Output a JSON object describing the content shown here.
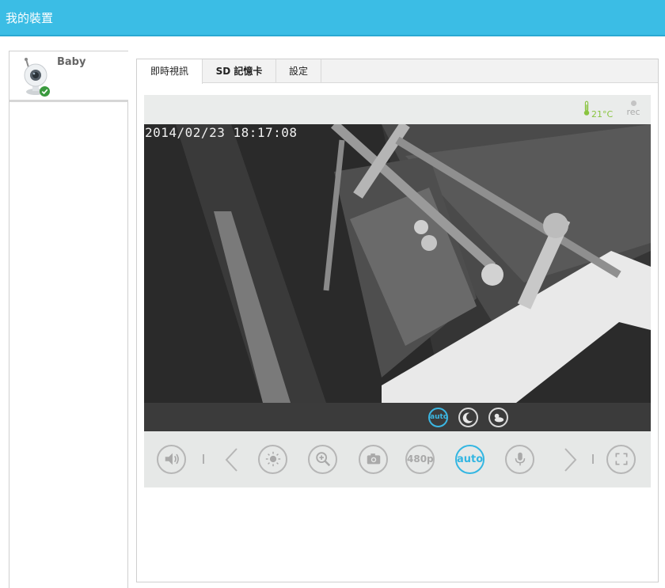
{
  "header": {
    "title": "我的裝置"
  },
  "devices": [
    {
      "name": "Baby",
      "status": "online"
    }
  ],
  "tabs": [
    {
      "label": "即時視訊",
      "active": true
    },
    {
      "label": "SD 記憶卡",
      "active": false
    },
    {
      "label": "設定",
      "active": false
    }
  ],
  "status": {
    "temperature": "21°C",
    "rec_label": "rec"
  },
  "video": {
    "timestamp": "2014/02/23 18:17:08"
  },
  "modes": [
    {
      "label": "auto",
      "icon": "auto-mode-icon",
      "selected": true
    },
    {
      "label": "",
      "icon": "night-mode-icon",
      "selected": false
    },
    {
      "label": "",
      "icon": "day-night-mode-icon",
      "selected": false
    }
  ],
  "controls": {
    "volume": "volume-icon",
    "prev": "chevron-left-icon",
    "brightness": "brightness-icon",
    "zoom": "zoom-in-icon",
    "snapshot": "camera-icon",
    "resolution_label": "480p",
    "mode_label": "auto",
    "mic": "microphone-icon",
    "next": "chevron-right-icon",
    "fullscreen": "fullscreen-icon"
  },
  "colors": {
    "header": "#3bbde5",
    "accent": "#33b6e2",
    "temp": "#8ac440"
  }
}
